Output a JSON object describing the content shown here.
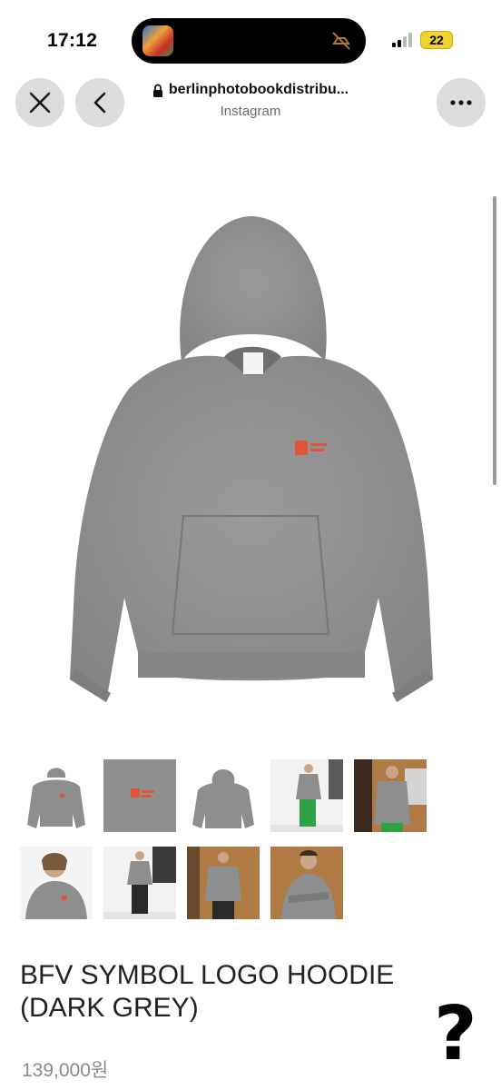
{
  "status_bar": {
    "time": "17:12",
    "battery": "22"
  },
  "browser": {
    "url": "berlinphotobookdistribu...",
    "source_app": "Instagram"
  },
  "product": {
    "name_line1": "BFV SYMBOL LOGO HOODIE",
    "name_line2": "(DARK GREY)",
    "price": "139,000원"
  },
  "overlay": {
    "mark": "?"
  },
  "colors": {
    "hoodie": "#8e8e8e",
    "logo": "#e0543a",
    "button_bg": "#dcdcdc",
    "price": "#8a8a8a"
  },
  "icons": [
    "close-icon",
    "back-chevron-icon",
    "lock-icon",
    "more-icon",
    "mute-icon",
    "signal-icon",
    "battery-icon"
  ]
}
